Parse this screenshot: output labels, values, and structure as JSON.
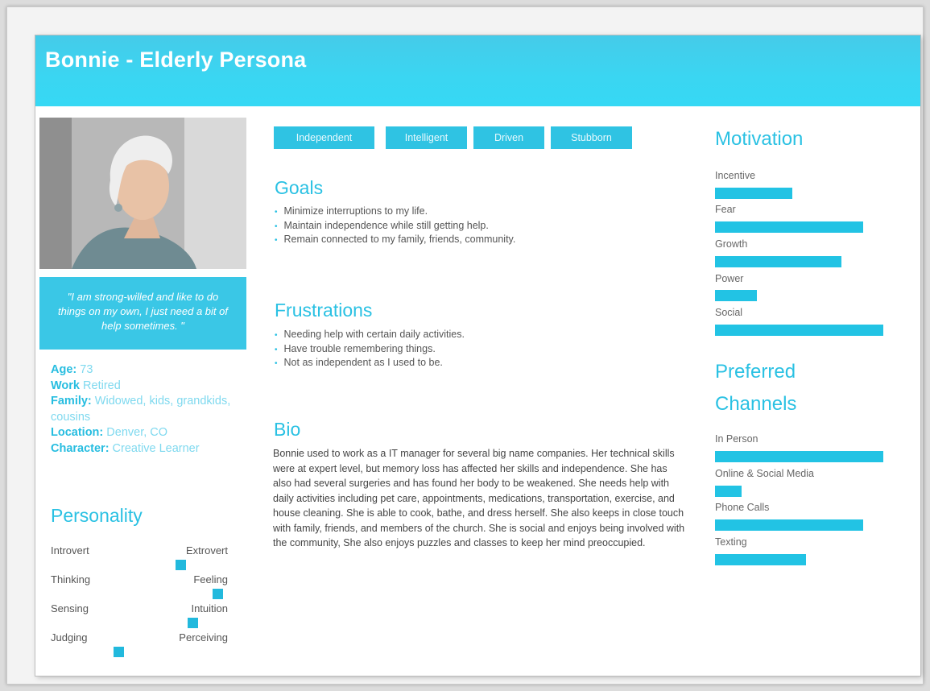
{
  "persona": {
    "title": "Bonnie - Elderly Persona",
    "quote": "\"I am strong-willed and like to do things on my own, I just need a bit of help sometimes. \"",
    "facts": [
      {
        "label": "Age:",
        "value": " 73"
      },
      {
        "label": "Work",
        "value": " Retired"
      },
      {
        "label": "Family:",
        "value": " Widowed, kids, grandkids, cousins"
      },
      {
        "label": "Location:",
        "value": " Denver, CO"
      },
      {
        "label": "Character:",
        "value": " Creative Learner"
      }
    ]
  },
  "personality": {
    "title": "Personality",
    "scales": [
      {
        "left": "Introvert",
        "right": "Extrovert",
        "level": 0.73
      },
      {
        "left": "Thinking",
        "right": "Feeling",
        "level": 0.94
      },
      {
        "left": "Sensing",
        "right": "Intuition",
        "level": 0.8
      },
      {
        "left": "Judging",
        "right": "Perceiving",
        "level": 0.38
      }
    ]
  },
  "tags": [
    "Independent",
    "Intelligent",
    "Driven",
    "Stubborn"
  ],
  "goals": {
    "title": "Goals",
    "items": [
      "Minimize interruptions to my life.",
      "Maintain independence while still getting help.",
      "Remain connected to my family, friends, community."
    ]
  },
  "frustrations": {
    "title": "Frustrations",
    "items": [
      "Needing help with certain daily activities.",
      "Have trouble remembering things.",
      "Not as independent as I used to be."
    ]
  },
  "bio": {
    "title": "Bio",
    "text": "Bonnie used to work as a IT manager for several big name companies. Her technical skills were at expert level, but memory loss has affected her skills and independence. She has also had several surgeries and has found her body to be weakened. She needs help with daily activities including pet care, appointments, medications, transportation, exercise, and house cleaning. She is able to cook, bathe, and dress herself. She also keeps in close touch with family, friends, and members of the church. She is social and enjoys being involved with the community, She also enjoys puzzles and classes to keep her mind preoccupied."
  },
  "motivation": {
    "title": "Motivation",
    "bars": [
      {
        "label": "Incentive",
        "level": 0.46
      },
      {
        "label": "Fear",
        "level": 0.88
      },
      {
        "label": "Growth",
        "level": 0.75
      },
      {
        "label": "Power",
        "level": 0.25
      },
      {
        "label": "Social",
        "level": 1.0
      }
    ]
  },
  "channels": {
    "title_line1": "Preferred",
    "title_line2": "Channels",
    "bars": [
      {
        "label": "In Person",
        "level": 1.0
      },
      {
        "label": "Online & Social Media",
        "level": 0.16
      },
      {
        "label": "Phone Calls",
        "level": 0.88
      },
      {
        "label": "Texting",
        "level": 0.54
      }
    ]
  },
  "colors": {
    "accent": "#2ac1e3",
    "header": "#3ad6f2",
    "bar": "#22c3e4"
  }
}
